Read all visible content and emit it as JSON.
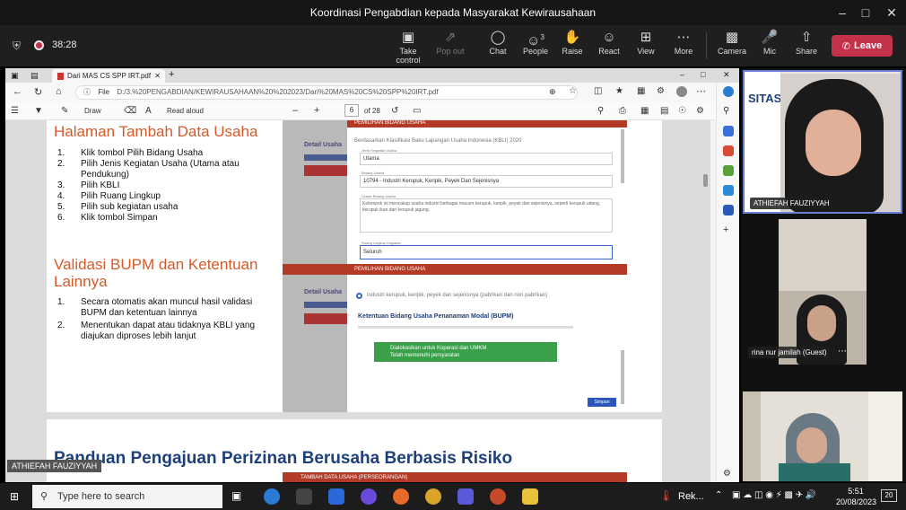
{
  "window": {
    "title": "Koordinasi Pengabdian kepada Masyarakat Kewirausahaan"
  },
  "meeting": {
    "timer": "38:28",
    "buttons": [
      {
        "label": "Take control",
        "icon": "screen-icon"
      },
      {
        "label": "Pop out",
        "icon": "popout-icon"
      },
      {
        "label": "Chat",
        "icon": "chat-icon"
      },
      {
        "label": "People",
        "icon": "people-icon",
        "badge": "3"
      },
      {
        "label": "Raise",
        "icon": "hand-icon"
      },
      {
        "label": "React",
        "icon": "smile-icon"
      },
      {
        "label": "View",
        "icon": "grid-icon"
      },
      {
        "label": "More",
        "icon": "more-icon"
      },
      {
        "label": "Camera",
        "icon": "camera-icon"
      },
      {
        "label": "Mic",
        "icon": "mic-icon"
      },
      {
        "label": "Share",
        "icon": "share-icon"
      }
    ],
    "leave": "Leave"
  },
  "browser": {
    "tab": "Dari MAS CS SPP IRT.pdf",
    "address_prefix": "File",
    "url": "D:/3.%20PENGABDIAN/KEWIRAUSAHAAN%20%202023/Dari%20MAS%20CS%20SPP%20IRT.pdf"
  },
  "pdf": {
    "draw": "Draw",
    "read_aloud": "Read aloud",
    "page": "6",
    "of": "of 28"
  },
  "slide1": {
    "title1": "Halaman Tambah Data Usaha",
    "steps1": [
      {
        "n": "1.",
        "t": "Klik tombol Pilih Bidang Usaha"
      },
      {
        "n": "2.",
        "t": "Pilih Jenis Kegiatan Usaha (Utama atau Pendukung)"
      },
      {
        "n": "3.",
        "t": "Pilih KBLI"
      },
      {
        "n": "4.",
        "t": "Pilih Ruang Lingkup"
      },
      {
        "n": "5.",
        "t": "Pilih sub kegiatan usaha"
      },
      {
        "n": "6.",
        "t": "Klik tombol Simpan"
      }
    ],
    "title2": "Validasi BUPM dan Ketentuan Lainnya",
    "steps2": [
      {
        "n": "1.",
        "t": "Secara otomatis akan muncul hasil validasi BUPM dan ketentuan lainnya"
      },
      {
        "n": "2.",
        "t": "Menentukan dapat atau tidaknya KBLI yang diajukan diproses lebih lanjut"
      }
    ]
  },
  "shot1": {
    "bg_label": "Detail Usaha",
    "modal_title": "PEMILIHAN BIDANG USAHA",
    "sub": "Berdasarkan Klasifikasi Baku Lapangan Usaha Indonesia (KBLI) 2020",
    "f1_label": "Jenis Kegiatan Usaha",
    "f1_value": "Utama",
    "f2_label": "Bidang Usaha",
    "f2_value": "10794 - Industri Kerupuk, Keripik, Peyek Dan Sejenisnya",
    "f3_label": "Uraian Bidang Usaha",
    "f3_value": "Kelompok ini mencakup usaha industri berbagai macam kerupuk, keripik, peyek dan sejenisnya, seperti kerupuk udang, kerupuk ikan dan kerupuk jagung.",
    "f4_label": "Ruang Lingkup Kegiatan",
    "f4_value": "Seluruh"
  },
  "shot2": {
    "bg_label": "Detail Usaha",
    "modal_title": "PEMILIHAN BIDANG USAHA",
    "radio": "Industri kerupuk, keripik, peyek dan sejenisnya (pabrikan dan non pabrikan)",
    "heading": "Ketentuan Bidang Usaha Penanaman Modal (BUPM)",
    "green1": "Dialokasikan untuk Koperasi dan UMKM",
    "green2": "Telah memenuhi persyaratan",
    "save": "Simpan"
  },
  "slide2": {
    "title": "Panduan Pengajuan Perizinan Berusaha Berbasis Risiko",
    "bar": "TAMBAH DATA USAHA (PERSEORANGAN)"
  },
  "presenter": "ATHIEFAH FAUZIYYAH",
  "tiles": [
    {
      "name": "ATHIEFAH FAUZIYYAH",
      "banner": "SITAS TE"
    },
    {
      "name": "rina nur jamilah (Guest)"
    }
  ],
  "taskbar": {
    "search": "Type here to search",
    "weather": "Rek...",
    "time": "5:51",
    "date": "20/08/2023",
    "notif": "20"
  }
}
